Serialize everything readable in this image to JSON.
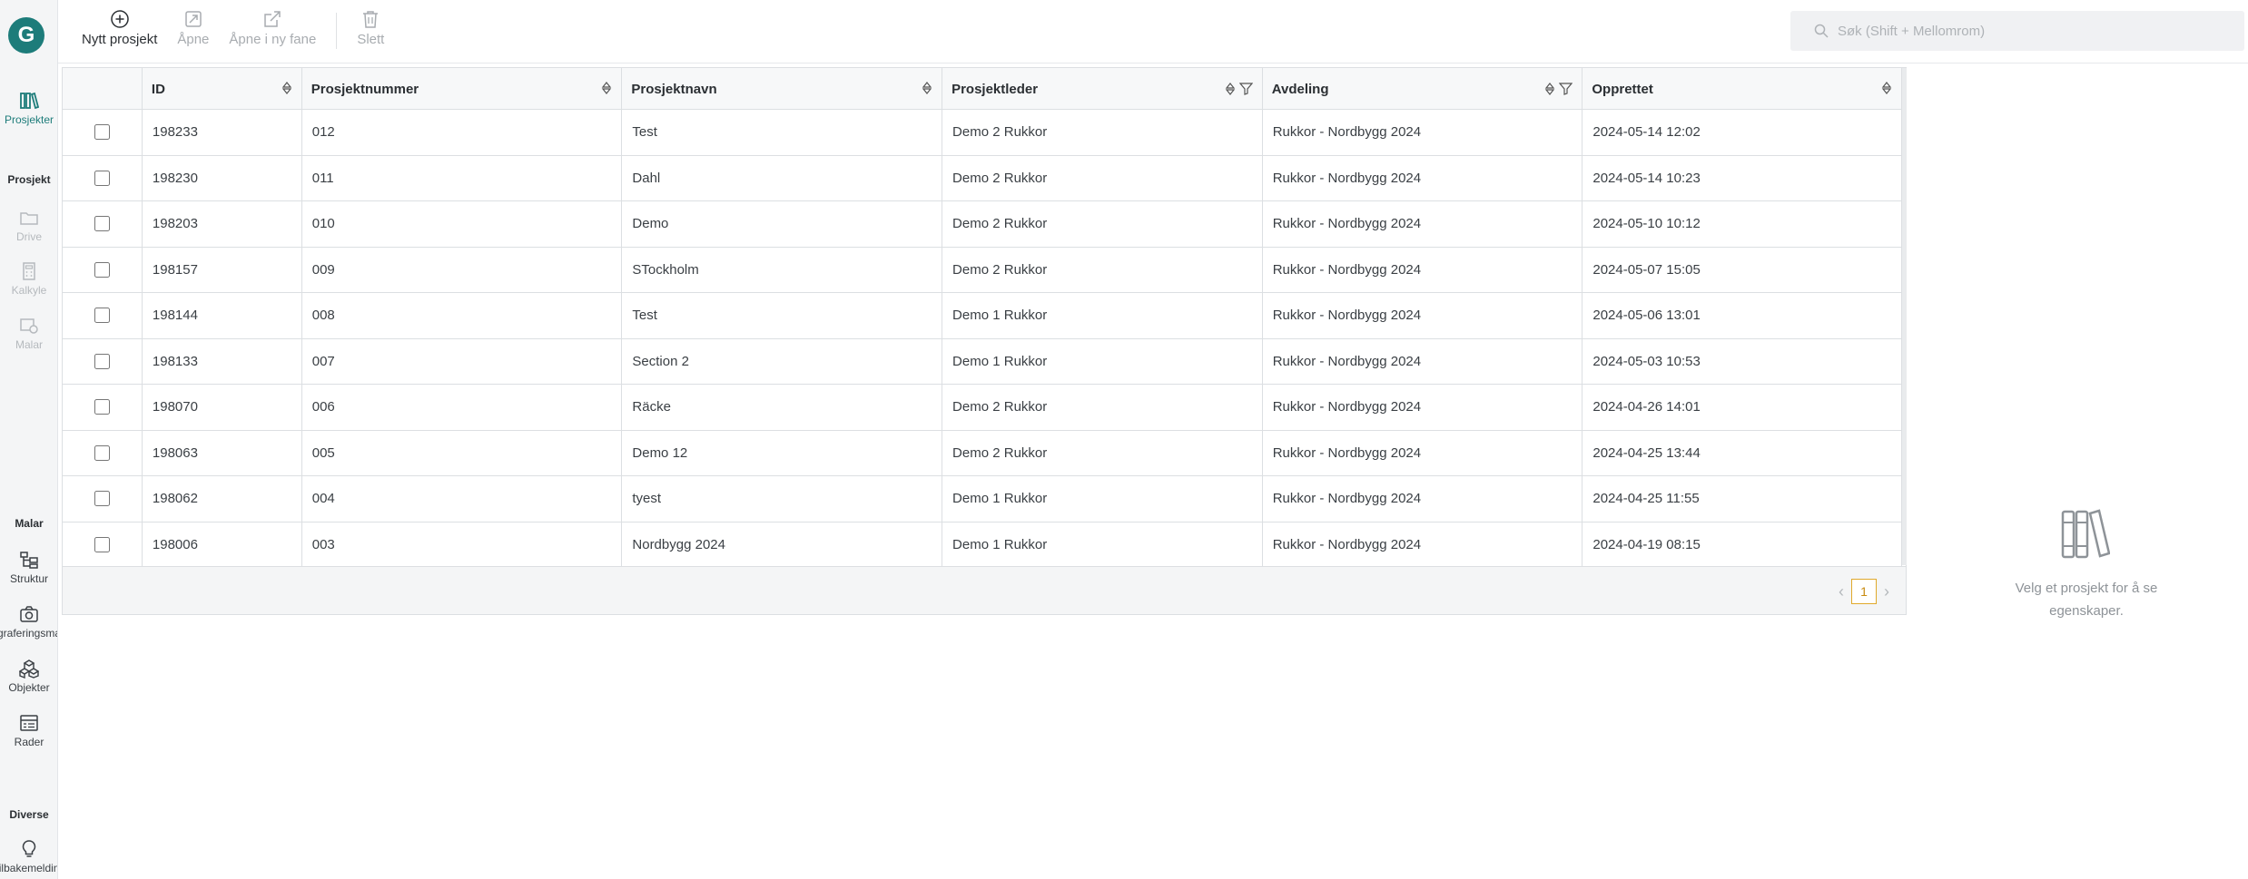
{
  "sidebar": {
    "logo_letter": "G",
    "items_top": [
      {
        "label": "Prosjekter",
        "icon": "books-icon",
        "state": "active"
      }
    ],
    "section_prosjekt": "Prosjekt",
    "items_prosjekt": [
      {
        "label": "Drive",
        "icon": "folder-icon",
        "state": "disabled"
      },
      {
        "label": "Kalkyle",
        "icon": "calculator-icon",
        "state": "disabled"
      },
      {
        "label": "Malar",
        "icon": "template-icon",
        "state": "disabled"
      }
    ],
    "section_malar": "Malar",
    "items_malar": [
      {
        "label": "Struktur",
        "icon": "structure-icon"
      },
      {
        "label": "Fotograferingsmapper",
        "icon": "camera-icon"
      },
      {
        "label": "Objekter",
        "icon": "objects-icon"
      },
      {
        "label": "Rader",
        "icon": "rows-icon"
      }
    ],
    "section_diverse": "Diverse",
    "items_diverse": [
      {
        "label": "Tilbakemelding",
        "icon": "lightbulb-icon"
      }
    ]
  },
  "toolbar": {
    "new_label": "Nytt prosjekt",
    "open_label": "Åpne",
    "open_new_tab_label": "Åpne i ny fane",
    "delete_label": "Slett"
  },
  "search": {
    "placeholder": "Søk (Shift + Mellomrom)"
  },
  "table": {
    "columns": [
      {
        "label": "ID",
        "sortable": true,
        "filterable": false
      },
      {
        "label": "Prosjektnummer",
        "sortable": true,
        "filterable": false
      },
      {
        "label": "Prosjektnavn",
        "sortable": true,
        "filterable": false
      },
      {
        "label": "Prosjektleder",
        "sortable": true,
        "filterable": true
      },
      {
        "label": "Avdeling",
        "sortable": true,
        "filterable": true
      },
      {
        "label": "Opprettet",
        "sortable": true,
        "filterable": false
      }
    ],
    "rows": [
      [
        "198233",
        "012",
        "Test",
        "Demo 2 Rukkor",
        "Rukkor - Nordbygg 2024",
        "2024-05-14 12:02"
      ],
      [
        "198230",
        "011",
        "Dahl",
        "Demo 2 Rukkor",
        "Rukkor - Nordbygg 2024",
        "2024-05-14 10:23"
      ],
      [
        "198203",
        "010",
        "Demo",
        "Demo 2 Rukkor",
        "Rukkor - Nordbygg 2024",
        "2024-05-10 10:12"
      ],
      [
        "198157",
        "009",
        "STockholm",
        "Demo 2 Rukkor",
        "Rukkor - Nordbygg 2024",
        "2024-05-07 15:05"
      ],
      [
        "198144",
        "008",
        "Test",
        "Demo 1 Rukkor",
        "Rukkor - Nordbygg 2024",
        "2024-05-06 13:01"
      ],
      [
        "198133",
        "007",
        "Section 2",
        "Demo 1 Rukkor",
        "Rukkor - Nordbygg 2024",
        "2024-05-03 10:53"
      ],
      [
        "198070",
        "006",
        "Räcke",
        "Demo 2 Rukkor",
        "Rukkor - Nordbygg 2024",
        "2024-04-26 14:01"
      ],
      [
        "198063",
        "005",
        "Demo 12",
        "Demo 2 Rukkor",
        "Rukkor - Nordbygg 2024",
        "2024-04-25 13:44"
      ],
      [
        "198062",
        "004",
        "tyest",
        "Demo 1 Rukkor",
        "Rukkor - Nordbygg 2024",
        "2024-04-25 11:55"
      ],
      [
        "198006",
        "003",
        "Nordbygg 2024",
        "Demo 1 Rukkor",
        "Rukkor - Nordbygg 2024",
        "2024-04-19 08:15"
      ]
    ],
    "current_page": "1"
  },
  "details_panel": {
    "empty_text": "Velg et prosjekt for å se egenskaper.",
    "icon": "books-icon"
  },
  "colors": {
    "accent": "#1d7c7a",
    "pager_accent": "#e0a92c"
  }
}
